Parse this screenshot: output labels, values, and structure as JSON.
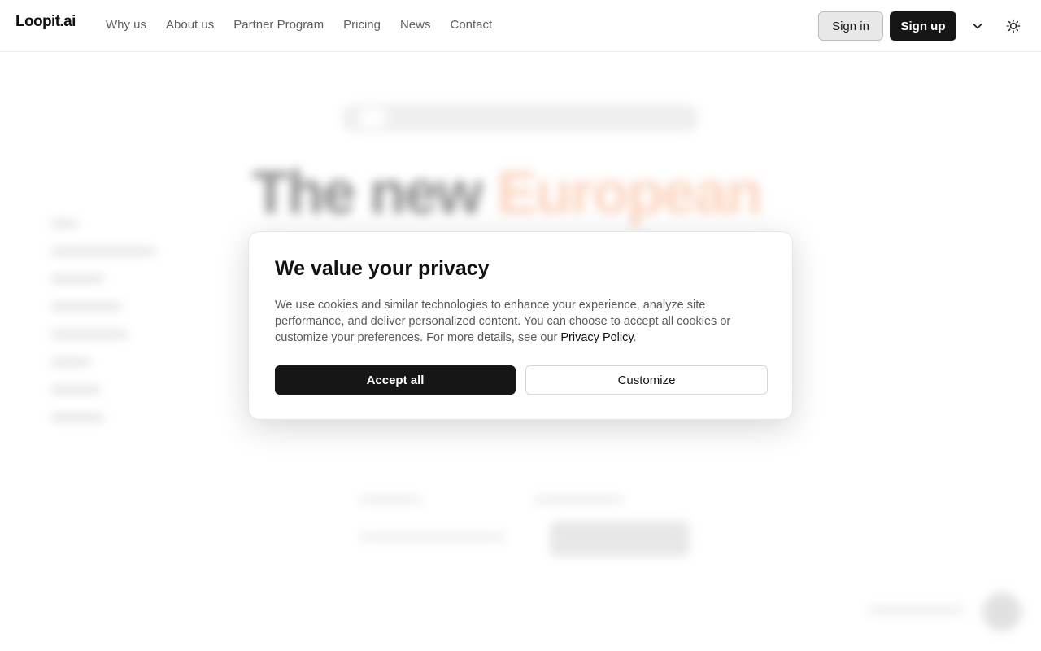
{
  "header": {
    "logo": "Loopit.ai",
    "nav": [
      {
        "label": "Why us"
      },
      {
        "label": "About us"
      },
      {
        "label": "Partner Program"
      },
      {
        "label": "Pricing"
      },
      {
        "label": "News"
      },
      {
        "label": "Contact"
      }
    ],
    "sign_in_label": "Sign in",
    "sign_up_label": "Sign up",
    "language_icon": "chevron-down-icon",
    "theme_icon": "sun-icon"
  },
  "background": {
    "headline_part1": "The new ",
    "headline_accent": "European"
  },
  "cookie_modal": {
    "title": "We value your privacy",
    "body": "We use cookies and similar technologies to enhance your experience, analyze site performance, and deliver personalized content. You can choose to accept all cookies or customize your preferences. For more details, see our ",
    "policy_link": "Privacy Policy",
    "body_end": ".",
    "accept_label": "Accept all",
    "customize_label": "Customize"
  },
  "colors": {
    "primary": "#161616",
    "accent": "#f7b08a",
    "muted_text": "#5f5f5f"
  }
}
